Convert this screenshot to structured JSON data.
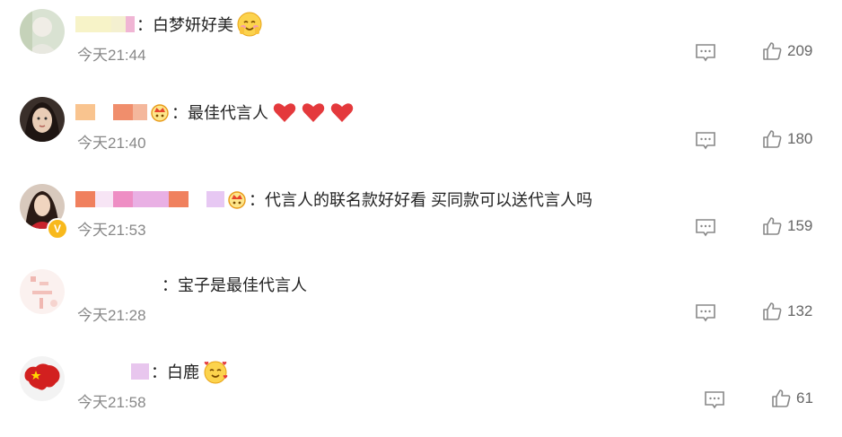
{
  "comments": [
    {
      "text": "：白梦妍好美",
      "time": "今天21:44",
      "likes": "209",
      "emoji": "blush-face-emoji",
      "blur_colors": [
        "#f7f3c8",
        "#f4f0d0",
        "#f0b5d4"
      ]
    },
    {
      "text": "：最佳代言人",
      "time": "今天21:40",
      "likes": "180",
      "emoji": "red-heart-emoji",
      "blur_colors": [
        "#f9c48f",
        "#ffffff",
        "#f08e6c",
        "#f4b79c"
      ]
    },
    {
      "text": "：代言人的联名款好好看 买同款可以送代言人吗",
      "time": "今天21:53",
      "likes": "159",
      "emoji": "crown-badge-icon",
      "blur_colors": [
        "#f0805e",
        "#f7e5f5",
        "#ee8ec4",
        "#e9b0e4",
        "#f0815e",
        "#ffffff",
        "#e7c8f3"
      ],
      "verified_badge": "V"
    },
    {
      "text": "：宝子是最佳代言人",
      "time": "今天21:28",
      "likes": "132",
      "blur_colors": []
    },
    {
      "text": "：白鹿",
      "time": "今天21:58",
      "likes": "61",
      "emoji": "hearts-face-emoji",
      "blur_colors": [
        "#e8c6ee"
      ]
    }
  ],
  "icons": {
    "reply": "comment-reply-icon",
    "like": "thumbs-up-icon"
  },
  "colors": {
    "text": "#222222",
    "time": "#888888",
    "icon": "#888888",
    "heart": "#e4393c",
    "badge": "#f8b91c"
  }
}
